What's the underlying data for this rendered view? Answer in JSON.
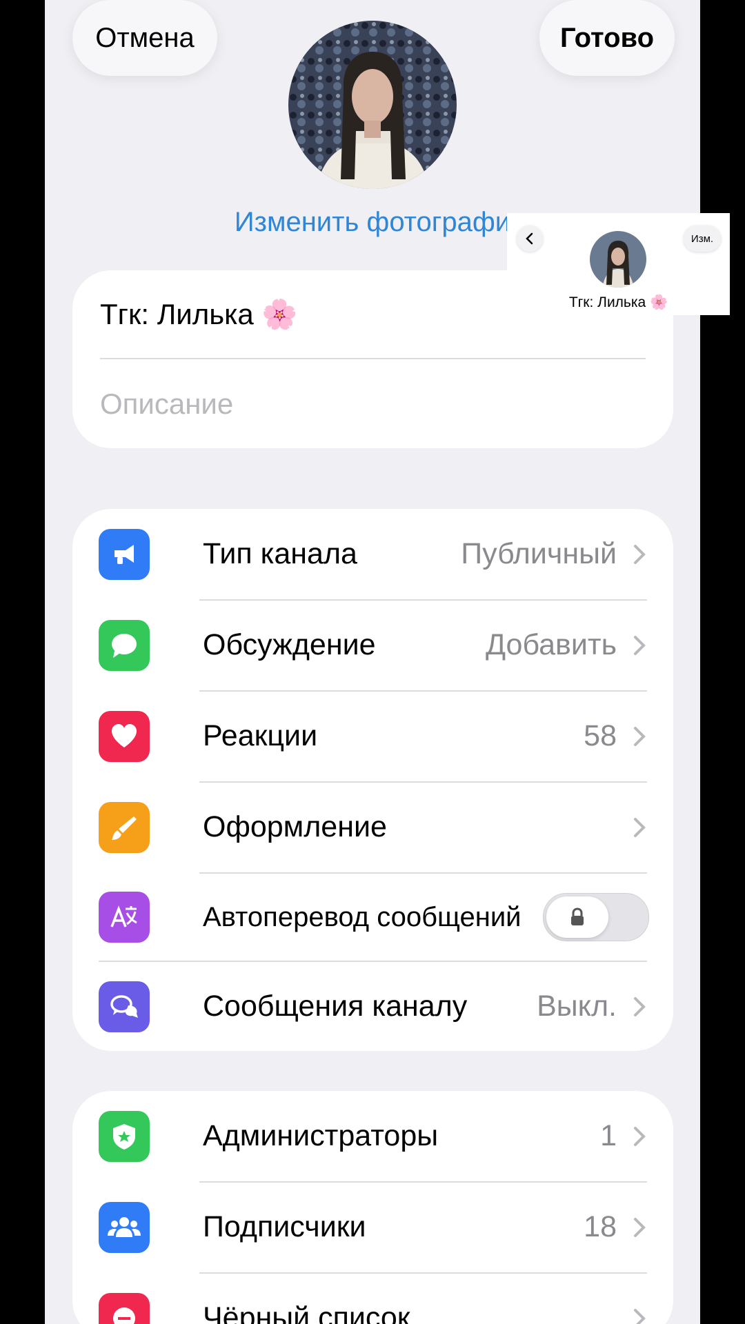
{
  "header": {
    "cancel_label": "Отмена",
    "done_label": "Готово",
    "change_photo_label": "Изменить фотографи"
  },
  "channel": {
    "name": "Тгк: Лилька 🌸",
    "description_placeholder": "Описание"
  },
  "settings": [
    {
      "label": "Тип канала",
      "value": "Публичный",
      "icon": "megaphone-icon",
      "color": "#2f7cf6"
    },
    {
      "label": "Обсуждение",
      "value": "Добавить",
      "icon": "chat-bubble-icon",
      "color": "#34c759"
    },
    {
      "label": "Реакции",
      "value": "58",
      "icon": "heart-icon",
      "color": "#f0284f"
    },
    {
      "label": "Оформление",
      "value": "",
      "icon": "brush-icon",
      "color": "#f6a01a"
    },
    {
      "label": "Автоперевод сообщений",
      "value": "",
      "icon": "translate-icon",
      "color": "#a64ee6",
      "toggle": "off-locked"
    },
    {
      "label": "Сообщения каналу",
      "value": "Выкл.",
      "icon": "chat-bubbles-icon",
      "color": "#6b5ce7"
    }
  ],
  "management": [
    {
      "label": "Администраторы",
      "value": "1",
      "icon": "shield-star-icon",
      "color": "#34c759"
    },
    {
      "label": "Подписчики",
      "value": "18",
      "icon": "people-icon",
      "color": "#2f7cf6"
    },
    {
      "label": "Чёрный список",
      "value": "",
      "icon": "minus-circle-icon",
      "color": "#f0284f"
    }
  ],
  "mini_preview": {
    "edit_label": "Изм.",
    "name": "Тгк: Лилька 🌸"
  }
}
